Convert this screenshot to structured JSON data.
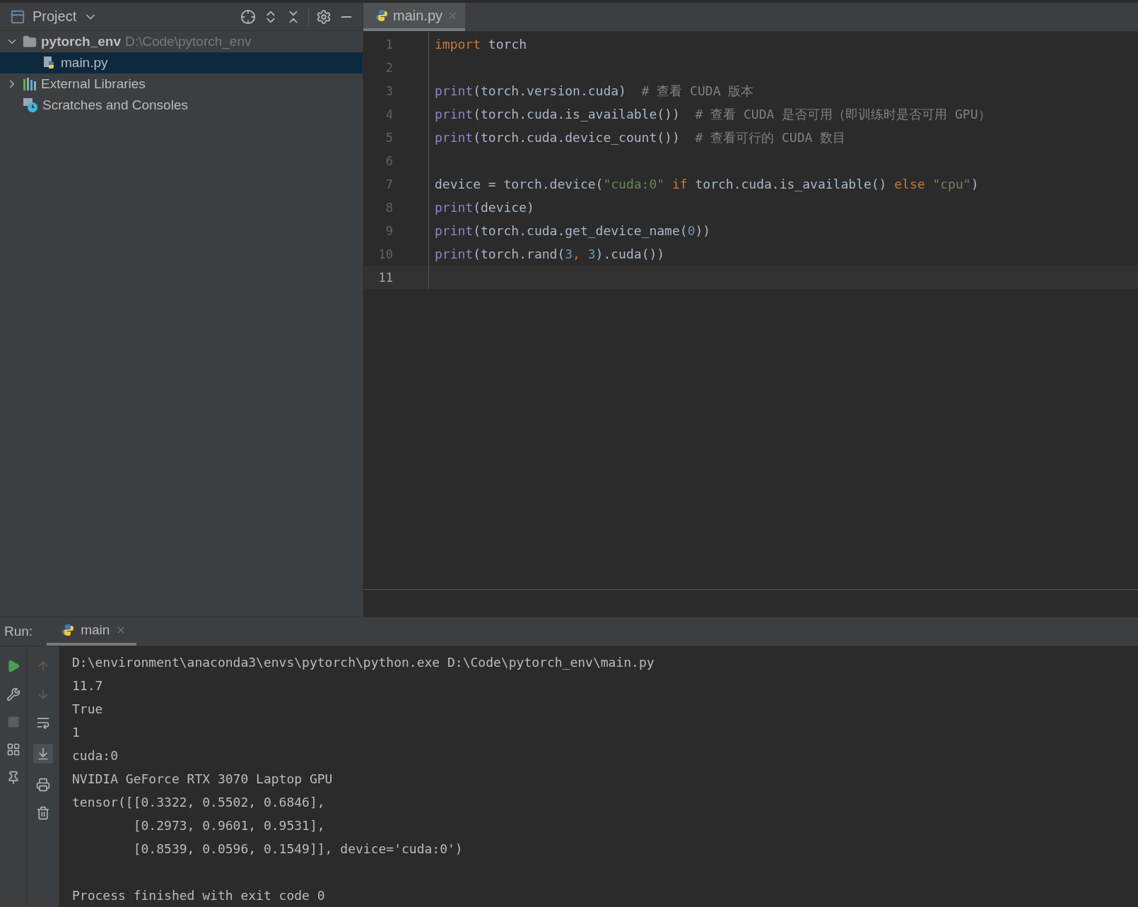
{
  "project_panel": {
    "title": "Project",
    "tree": [
      {
        "name": "pytorch_env",
        "path": "D:\\Code\\pytorch_env",
        "kind": "folder",
        "expanded": true,
        "selected": false,
        "children": [
          {
            "name": "main.py",
            "kind": "python",
            "selected": true
          }
        ]
      },
      {
        "name": "External Libraries",
        "kind": "libraries",
        "expanded": false,
        "selected": false
      },
      {
        "name": "Scratches and Consoles",
        "kind": "scratches",
        "selected": false
      }
    ]
  },
  "editor": {
    "tabs": [
      {
        "label": "main.py",
        "selected": true
      }
    ],
    "lines": [
      {
        "number": "1",
        "current": false,
        "tokens": [
          {
            "kind": "keyword",
            "text": "import"
          },
          {
            "kind": "plain",
            "text": " torch"
          }
        ]
      },
      {
        "number": "2",
        "current": false
      },
      {
        "number": "3",
        "current": false,
        "tokens": [
          {
            "kind": "builtin",
            "text": "print"
          },
          {
            "kind": "plain",
            "text": "(torch.version.cuda)  "
          },
          {
            "kind": "comment",
            "text": "# 查看 CUDA 版本"
          }
        ]
      },
      {
        "number": "4",
        "current": false,
        "tokens": [
          {
            "kind": "builtin",
            "text": "print"
          },
          {
            "kind": "plain",
            "text": "(torch.cuda.is_available())  "
          },
          {
            "kind": "comment",
            "text": "# 查看 CUDA 是否可用（即训练时是否可用 GPU）"
          }
        ]
      },
      {
        "number": "5",
        "current": false,
        "tokens": [
          {
            "kind": "builtin",
            "text": "print"
          },
          {
            "kind": "plain",
            "text": "(torch.cuda.device_count())  "
          },
          {
            "kind": "comment",
            "text": "# 查看可行的 CUDA 数目"
          }
        ]
      },
      {
        "number": "6",
        "current": false
      },
      {
        "number": "7",
        "current": false,
        "tokens": [
          {
            "kind": "plain",
            "text": "device = torch.device("
          },
          {
            "kind": "string",
            "text": "\"cuda:0\""
          },
          {
            "kind": "keyword",
            "text": " if "
          },
          {
            "kind": "plain",
            "text": "torch.cuda.is_available() "
          },
          {
            "kind": "keyword",
            "text": "else "
          },
          {
            "kind": "string",
            "text": "\"cpu\""
          },
          {
            "kind": "plain",
            "text": ")"
          }
        ]
      },
      {
        "number": "8",
        "current": false,
        "tokens": [
          {
            "kind": "builtin",
            "text": "print"
          },
          {
            "kind": "plain",
            "text": "(device)"
          }
        ]
      },
      {
        "number": "9",
        "current": false,
        "tokens": [
          {
            "kind": "builtin",
            "text": "print"
          },
          {
            "kind": "plain",
            "text": "(torch.cuda.get_device_name("
          },
          {
            "kind": "number",
            "text": "0"
          },
          {
            "kind": "plain",
            "text": "))"
          }
        ]
      },
      {
        "number": "10",
        "current": false,
        "tokens": [
          {
            "kind": "builtin",
            "text": "print"
          },
          {
            "kind": "plain",
            "text": "(torch.rand("
          },
          {
            "kind": "number",
            "text": "3"
          },
          {
            "kind": "keyword",
            "text": ", "
          },
          {
            "kind": "number",
            "text": "3"
          },
          {
            "kind": "plain",
            "text": ").cuda())"
          }
        ]
      },
      {
        "number": "11",
        "current": true
      }
    ]
  },
  "run_panel": {
    "label": "Run:",
    "tabs": [
      {
        "label": "main",
        "selected": true
      }
    ],
    "output": [
      "D:\\environment\\anaconda3\\envs\\pytorch\\python.exe D:\\Code\\pytorch_env\\main.py",
      "11.7",
      "True",
      "1",
      "cuda:0",
      "NVIDIA GeForce RTX 3070 Laptop GPU",
      "tensor([[0.3322, 0.5502, 0.6846],",
      "        [0.2973, 0.9601, 0.9531],",
      "        [0.8539, 0.0596, 0.1549]], device='cuda:0')"
    ],
    "exit_message": "Process finished with exit code 0"
  }
}
